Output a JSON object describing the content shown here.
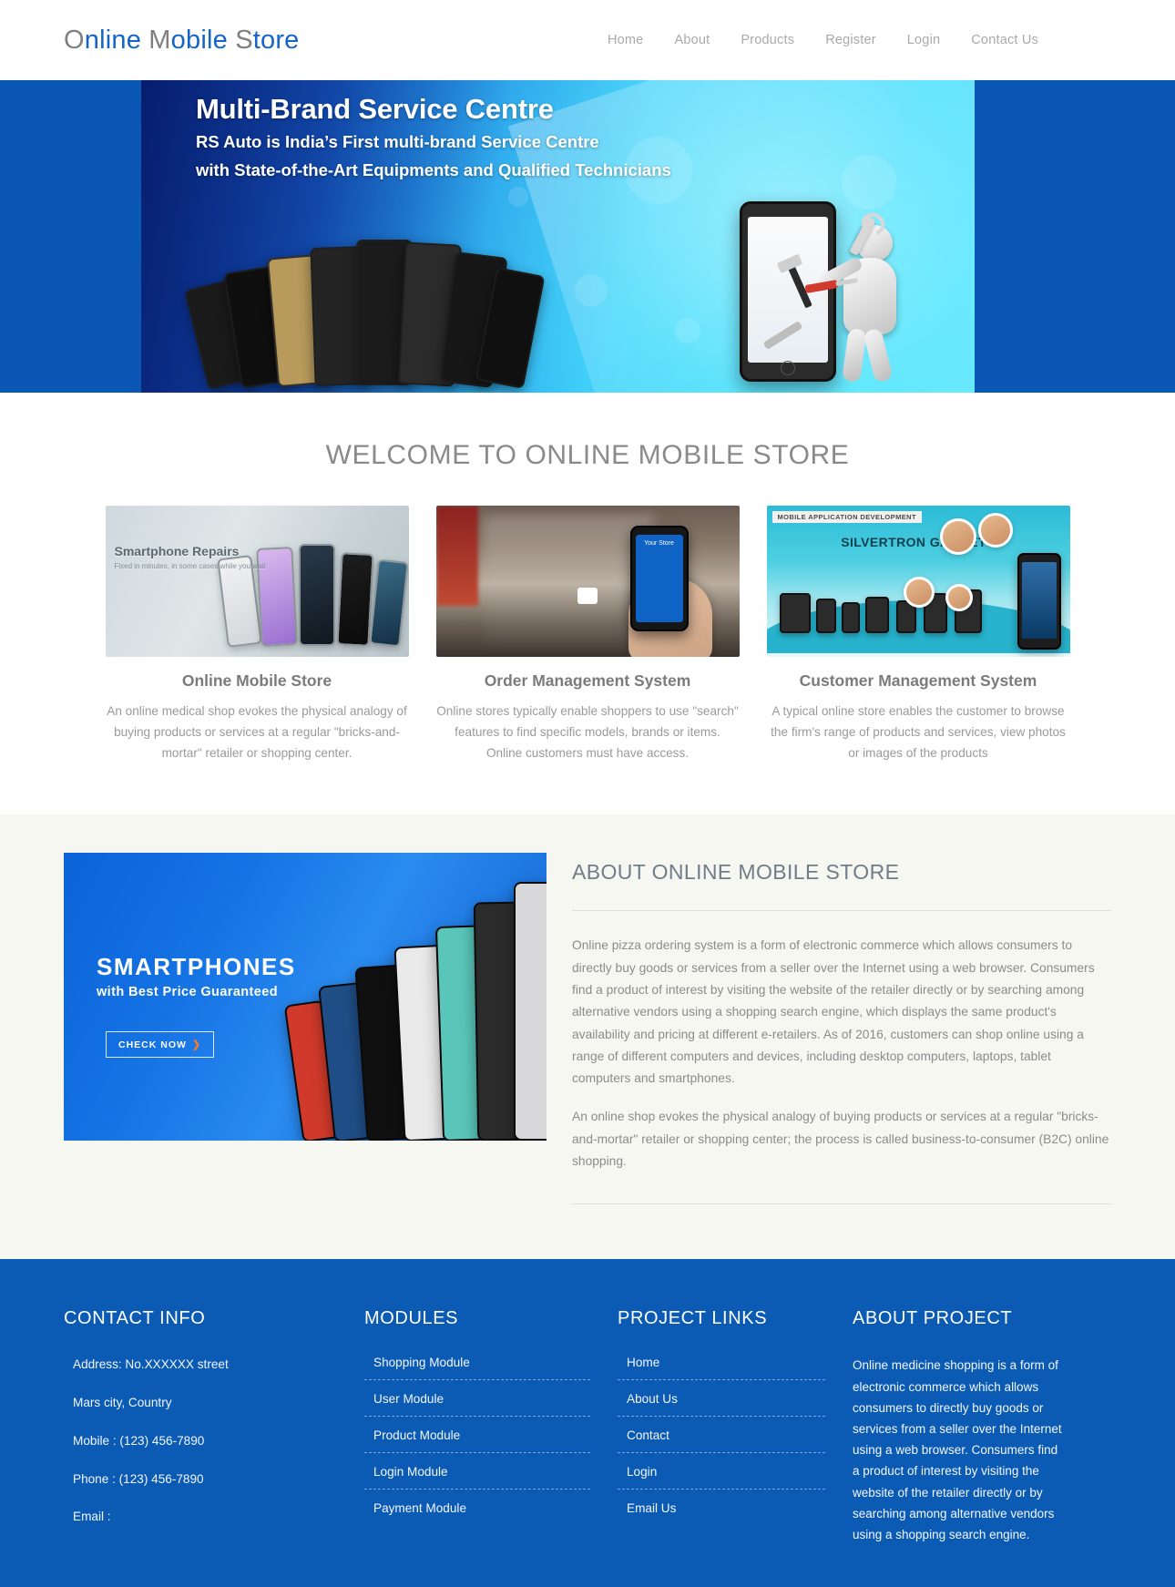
{
  "header": {
    "brand": {
      "part1": "O",
      "part2": "nline ",
      "part3": "M",
      "part4": "obile ",
      "part5": "S",
      "part6": "tore"
    },
    "nav": [
      {
        "label": "Home"
      },
      {
        "label": "About"
      },
      {
        "label": "Products"
      },
      {
        "label": "Register"
      },
      {
        "label": "Login"
      },
      {
        "label": "Contact Us"
      }
    ]
  },
  "hero": {
    "title": "Multi-Brand Service Centre",
    "line2": "RS Auto is India’s First multi-brand  Service Centre",
    "line3": "with State-of-the-Art  Equipments and Qualified Technicians",
    "bg_color": "#0b57b5"
  },
  "welcome": {
    "title": "WELCOME TO ONLINE MOBILE STORE",
    "cards": [
      {
        "title": "Online Mobile Store",
        "text": "An online medical shop evokes the physical analogy of buying products or services at a regular \"bricks-and-mortar\" retailer or shopping center.",
        "image_caption": "Smartphone Repairs",
        "image_subcaption": "Fixed in minutes, in some cases while you wait"
      },
      {
        "title": "Order Management System",
        "text": "Online stores typically enable shoppers to use \"search\" features to find specific models, brands or items. Online customers must have access.",
        "image_caption": "Your Store"
      },
      {
        "title": "Customer Management System",
        "text": "A typical online store enables the customer to browse the firm's range of products and services, view photos or images of the products",
        "image_caption": "SILVERTRON GADGETS",
        "image_tag": "MOBILE APPLICATION DEVELOPMENT"
      }
    ]
  },
  "about": {
    "title": "ABOUT ONLINE MOBILE STORE",
    "banner": {
      "headline": "SMARTPHONES",
      "subheadline": "with Best Price Guaranteed",
      "button_label": "CHECK NOW",
      "button_arrow": "❯"
    },
    "paragraphs": [
      "Online pizza ordering system is a form of electronic commerce which allows consumers to directly buy goods or services from a seller over the Internet using a web browser. Consumers find a product of interest by visiting the website of the retailer directly or by searching among alternative vendors using a shopping search engine, which displays the same product's availability and pricing at different e-retailers. As of 2016, customers can shop online using a range of different computers and devices, including desktop computers, laptops, tablet computers and smartphones.",
      "An online shop evokes the physical analogy of buying products or services at a regular \"bricks-and-mortar\" retailer or shopping center; the process is called business-to-consumer (B2C) online shopping."
    ],
    "bg_color": "#f7f7f2"
  },
  "footer": {
    "bg_color": "#0b5bb5",
    "contact": {
      "title": "CONTACT INFO",
      "items": [
        "Address: No.XXXXXX street",
        "Mars city, Country",
        "Mobile : (123) 456-7890",
        "Phone : (123) 456-7890",
        "Email :"
      ]
    },
    "modules": {
      "title": "MODULES",
      "items": [
        "Shopping Module",
        "User Module",
        "Product Module",
        "Login Module",
        "Payment Module"
      ]
    },
    "project_links": {
      "title": "PROJECT LINKS",
      "items": [
        "Home",
        "About Us",
        "Contact",
        "Login",
        "Email Us"
      ]
    },
    "about_project": {
      "title": "ABOUT PROJECT",
      "text": "Online medicine shopping is a form of electronic commerce which allows consumers to directly buy goods or services from a seller over the Internet using a web browser. Consumers find a product of interest by visiting the website of the retailer directly or by searching among alternative vendors using a shopping search engine."
    }
  }
}
